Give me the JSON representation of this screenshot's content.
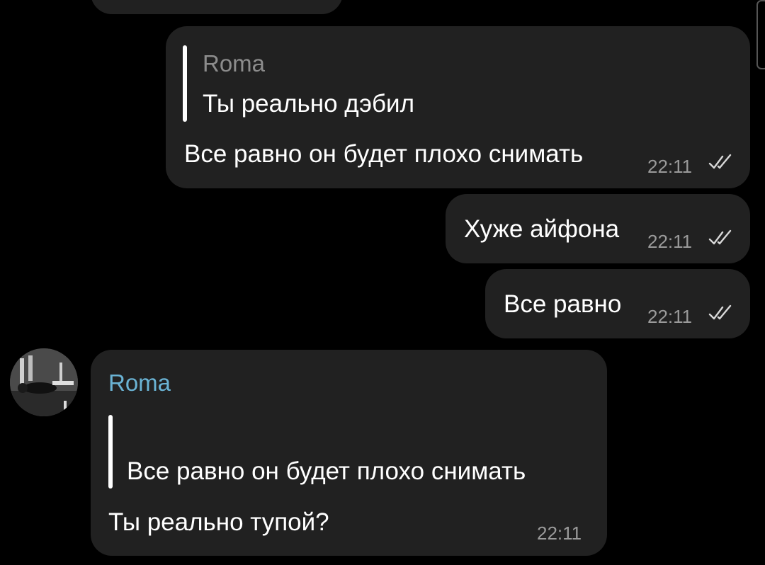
{
  "messages": [
    {
      "reply": {
        "name": "Roma",
        "text": "Ты реально дэбил"
      },
      "text": "Все равно он будет плохо снимать",
      "time": "22:11"
    },
    {
      "text": "Хуже айфона",
      "time": "22:11"
    },
    {
      "text": "Все равно",
      "time": "22:11"
    },
    {
      "sender": "Roma",
      "reply": {
        "text": "Все равно он будет плохо снимать"
      },
      "text": "Ты реально тупой?",
      "time": "22:11"
    }
  ],
  "colors": {
    "background": "#000000",
    "bubble": "#212121",
    "sender_name": "#6ab3d4",
    "quoted_name": "#8c8c8c",
    "time": "#9a9a9a"
  },
  "icons": {
    "read_status": "double-check-icon",
    "avatar": "user-avatar"
  }
}
